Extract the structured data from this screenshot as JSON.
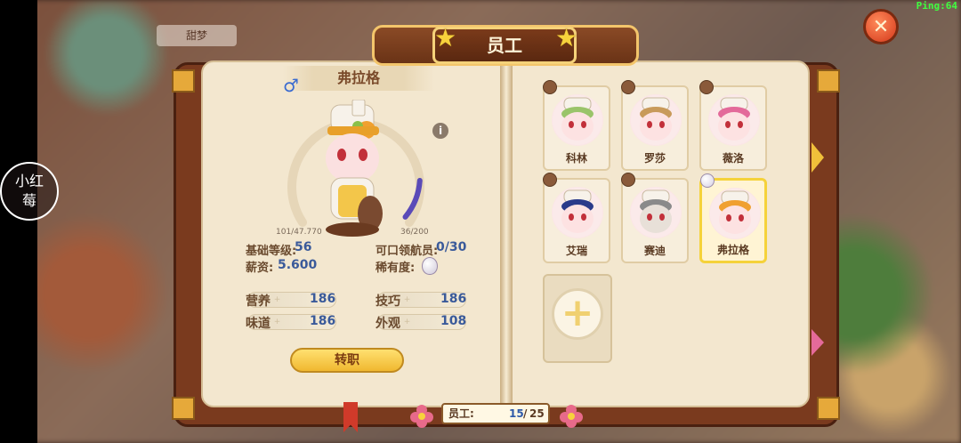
{
  "hud": {
    "ping": "Ping:64",
    "side_badge": "小红莓",
    "bg_label": "甜梦"
  },
  "window": {
    "title": "员工"
  },
  "employee": {
    "name": "弗拉格",
    "gender_symbol": "♂",
    "exp": "101/47.770",
    "recruit_progress": "36/200",
    "base_level_label": "基础等级:",
    "base_level": "56",
    "salary_label": "薪资:",
    "salary": "5.600",
    "recruitable_label": "可口领航员:",
    "recruitable": "0/30",
    "rarity_label": "稀有度:",
    "recruit_fill": 0.18,
    "attributes": [
      {
        "label": "营养",
        "value": "186"
      },
      {
        "label": "技巧",
        "value": "186"
      },
      {
        "label": "味道",
        "value": "186"
      },
      {
        "label": "外观",
        "value": "108"
      }
    ],
    "transfer_button": "转职"
  },
  "roster": {
    "members": [
      {
        "name": "科林",
        "hair": "#9ac46a",
        "skin": "#fde2e2"
      },
      {
        "name": "罗莎",
        "hair": "#c89a5a",
        "skin": "#fde2e2"
      },
      {
        "name": "薇洛",
        "hair": "#e36a9a",
        "skin": "#fde2e2"
      },
      {
        "name": "艾瑞",
        "hair": "#2a3a8a",
        "skin": "#fde2e2"
      },
      {
        "name": "赛迪",
        "hair": "#8a8a8a",
        "skin": "#e8e0d8"
      },
      {
        "name": "弗拉格",
        "hair": "#f0a030",
        "skin": "#fde2e2"
      }
    ],
    "selected_index": 5,
    "add_symbol": "+"
  },
  "footer": {
    "count_label": "员工:",
    "count_current": "15",
    "count_max": "25"
  }
}
